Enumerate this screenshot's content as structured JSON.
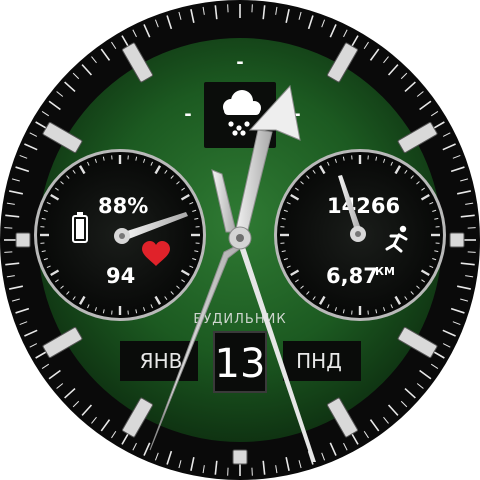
{
  "top_indicator": "-",
  "weather": {
    "left_dash": "-",
    "right_dash": "-",
    "icon": "rain-cloud-icon"
  },
  "left_subdial": {
    "battery_percent": "88%",
    "battery_icon": "battery-icon",
    "heart_rate": "94",
    "heart_icon": "heart-icon"
  },
  "right_subdial": {
    "steps": "14266",
    "steps_icon": "running-person-icon",
    "distance": "6,87",
    "distance_unit": "КМ"
  },
  "alarm_label": "БУДИЛЬНИК",
  "date": {
    "month": "ЯНВ",
    "day": "13",
    "weekday": "ПНД"
  },
  "colors": {
    "dial": "#1d5a22",
    "bezel": "#080808",
    "subdial": "#0a0c0a",
    "heart": "#e0222a",
    "hands": "#d6d6d6"
  }
}
